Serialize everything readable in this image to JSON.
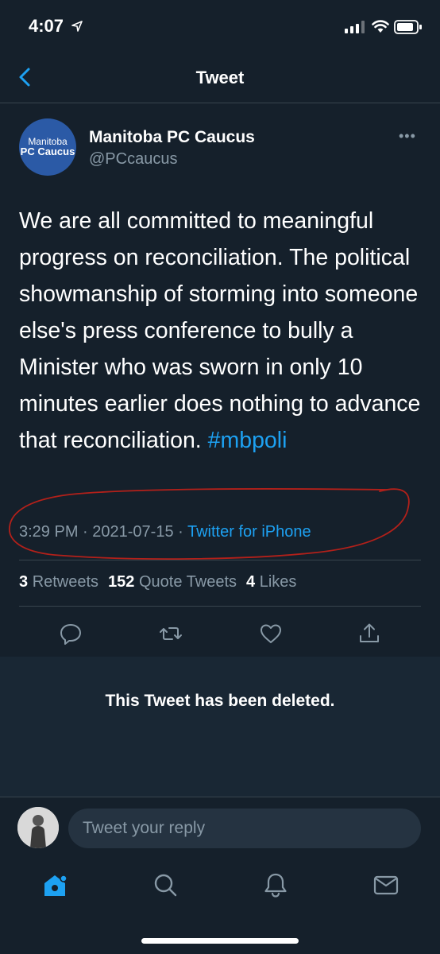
{
  "status_bar": {
    "time": "4:07"
  },
  "nav": {
    "title": "Tweet"
  },
  "tweet": {
    "avatar_line1": "Manitoba",
    "avatar_line2": "PC Caucus",
    "name": "Manitoba PC Caucus",
    "handle": "@PCcaucus",
    "more": "•••",
    "text": "We are all committed to meaningful progress on reconciliation. The political showmanship of storming into someone else's press conference to bully a Minister who was sworn in only 10 minutes earlier does nothing to advance that reconciliation. ",
    "hashtag": "#mbpoli",
    "time": "3:29 PM",
    "separator": " · ",
    "date": "2021-07-15",
    "source": "Twitter for iPhone"
  },
  "stats": {
    "retweets_count": "3",
    "retweets_label": "Retweets",
    "quotes_count": "152",
    "quotes_label": "Quote Tweets",
    "likes_count": "4",
    "likes_label": "Likes"
  },
  "deleted": {
    "message": "This Tweet has been deleted."
  },
  "reply": {
    "placeholder": "Tweet your reply"
  },
  "icons": {
    "actions": [
      "reply-icon",
      "retweet-icon",
      "like-icon",
      "share-icon"
    ],
    "tabs": [
      "home-icon",
      "search-icon",
      "notifications-icon",
      "messages-icon"
    ]
  },
  "colors": {
    "background": "#15202b",
    "accent": "#1da1f2",
    "secondary_text": "#8899a6",
    "annotation": "#b3201a"
  }
}
